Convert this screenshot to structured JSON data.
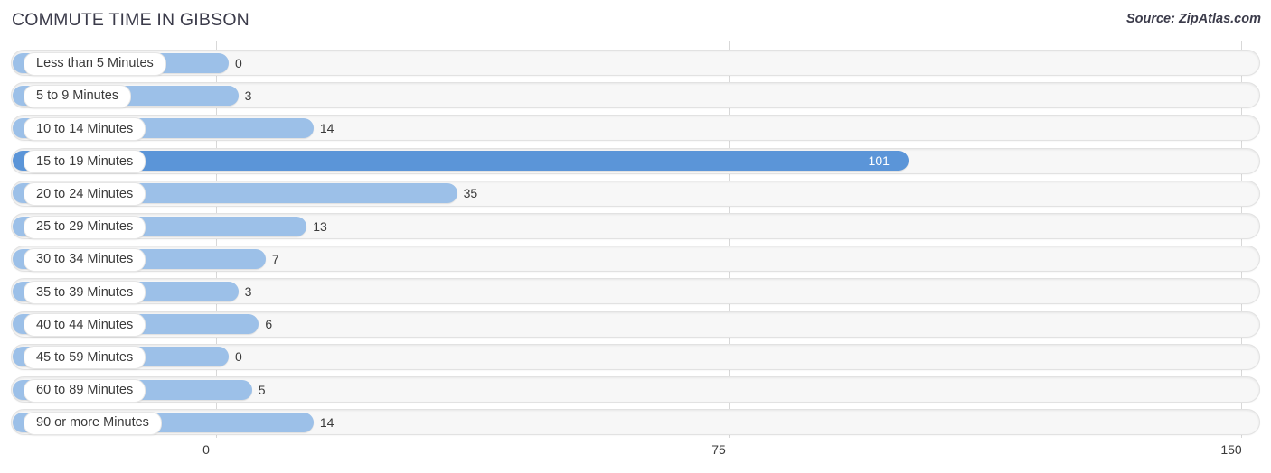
{
  "header": {
    "title": "COMMUTE TIME IN GIBSON",
    "source": "Source: ZipAtlas.com"
  },
  "colors": {
    "bar": "#9CC0E8",
    "bar_highlight": "#5B95D8",
    "track": "#f7f7f7",
    "gridline": "#d8d8d8",
    "text": "#3a3a3a",
    "title": "#3b3b4a"
  },
  "axis": {
    "ticks": [
      "0",
      "75",
      "150"
    ],
    "min": 0,
    "max": 150
  },
  "chart_data": {
    "type": "bar",
    "orientation": "horizontal",
    "title": "COMMUTE TIME IN GIBSON",
    "xlabel": "",
    "ylabel": "",
    "xlim": [
      0,
      150
    ],
    "grid": true,
    "legend": null,
    "source": "Source: ZipAtlas.com",
    "categories": [
      "Less than 5 Minutes",
      "5 to 9 Minutes",
      "10 to 14 Minutes",
      "15 to 19 Minutes",
      "20 to 24 Minutes",
      "25 to 29 Minutes",
      "30 to 34 Minutes",
      "35 to 39 Minutes",
      "40 to 44 Minutes",
      "45 to 59 Minutes",
      "60 to 89 Minutes",
      "90 or more Minutes"
    ],
    "values": [
      0,
      3,
      14,
      101,
      35,
      13,
      7,
      3,
      6,
      0,
      5,
      14
    ],
    "value_labels": [
      "0",
      "3",
      "14",
      "101",
      "35",
      "13",
      "7",
      "3",
      "6",
      "0",
      "5",
      "14"
    ],
    "highlight_index": 3
  }
}
